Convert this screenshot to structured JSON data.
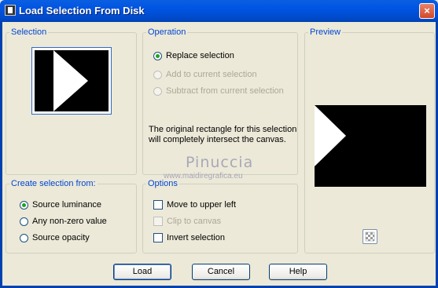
{
  "window": {
    "title": "Load Selection From Disk",
    "close_glyph": "×"
  },
  "selection_group": {
    "legend": "Selection"
  },
  "operation_group": {
    "legend": "Operation",
    "options": [
      "Replace selection",
      "Add to current selection",
      "Subtract from current selection"
    ],
    "selected": "Replace selection",
    "info_line1": "The original rectangle for this selection",
    "info_line2": "will completely intersect the canvas."
  },
  "preview_group": {
    "legend": "Preview",
    "toggle_icon": "checkerboard-icon"
  },
  "create_group": {
    "legend": "Create selection from:",
    "options": [
      "Source luminance",
      "Any non-zero value",
      "Source opacity"
    ],
    "selected": "Source luminance"
  },
  "options_group": {
    "legend": "Options",
    "items": [
      {
        "label": "Move to upper left",
        "checked": false,
        "enabled": true
      },
      {
        "label": "Clip to canvas",
        "checked": false,
        "enabled": false
      },
      {
        "label": "Invert selection",
        "checked": false,
        "enabled": true
      }
    ]
  },
  "buttons": {
    "load": "Load",
    "cancel": "Cancel",
    "help": "Help"
  },
  "watermark": {
    "name": "Pinuccia",
    "url": "www.maidiregrafica.eu"
  },
  "colors": {
    "title_bar": "#0054e3",
    "legend": "#0046d5",
    "dialog_bg": "#ece9d8"
  }
}
